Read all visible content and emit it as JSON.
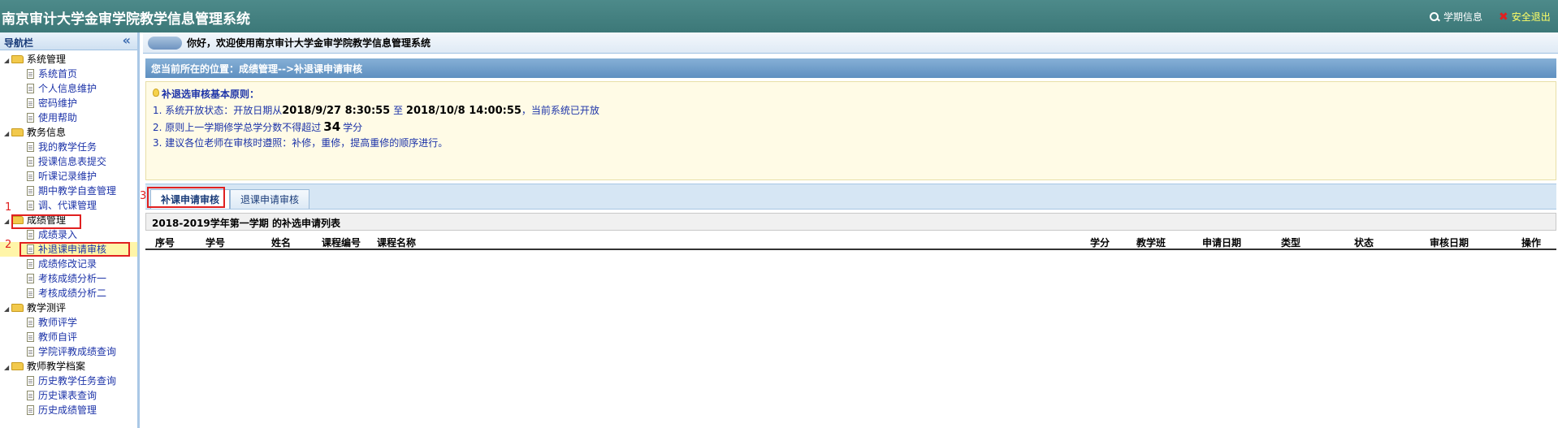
{
  "header": {
    "title": "南京审计大学金审学院教学信息管理系统",
    "term_info": "学期信息",
    "logout": "安全退出"
  },
  "sidebar": {
    "title": "导航栏",
    "collapse_icon": "«",
    "groups": [
      {
        "label": "系统管理",
        "items": [
          "系统首页",
          "个人信息维护",
          "密码维护",
          "使用帮助"
        ]
      },
      {
        "label": "教务信息",
        "items": [
          "我的教学任务",
          "授课信息表提交",
          "听课记录维护",
          "期中教学自查管理",
          "调、代课管理"
        ]
      },
      {
        "label": "成绩管理",
        "items": [
          "成绩录入",
          "补退课申请审核",
          "成绩修改记录",
          "考核成绩分析一",
          "考核成绩分析二"
        ]
      },
      {
        "label": "教学测评",
        "items": [
          "教师评学",
          "教师自评",
          "学院评教成绩查询"
        ]
      },
      {
        "label": "教师教学档案",
        "items": [
          "历史教学任务查询",
          "历史课表查询",
          "历史成绩管理"
        ]
      }
    ]
  },
  "annotations": {
    "one": "1",
    "two": "2",
    "three": "3"
  },
  "main": {
    "welcome": "你好，欢迎使用南京审计大学金审学院教学信息管理系统",
    "location": "您当前所在的位置：成绩管理-->补退课申请审核",
    "rules": {
      "title": "补退选审核基本原则：",
      "line1_prefix": "1. 系统开放状态：开放日期从",
      "line1_start": "2018/9/27 8:30:55",
      "line1_mid": "至",
      "line1_end": "2018/10/8 14:00:55",
      "line1_suffix": "，当前系统已开放",
      "line2_prefix": "2. 原则上一学期修学总学分数不得超过",
      "line2_num": "34",
      "line2_suffix": "学分",
      "line3": "3. 建议各位老师在审核时遵照：补修，重修，提高重修的顺序进行。"
    },
    "tabs": [
      "补课申请审核",
      "退课申请审核"
    ],
    "list_title": "2018-2019学年第一学期 的补选申请列表",
    "columns": [
      "序号",
      "学号",
      "姓名",
      "课程编号",
      "课程名称",
      "学分",
      "教学班",
      "申请日期",
      "类型",
      "状态",
      "审核日期",
      "操作"
    ]
  }
}
